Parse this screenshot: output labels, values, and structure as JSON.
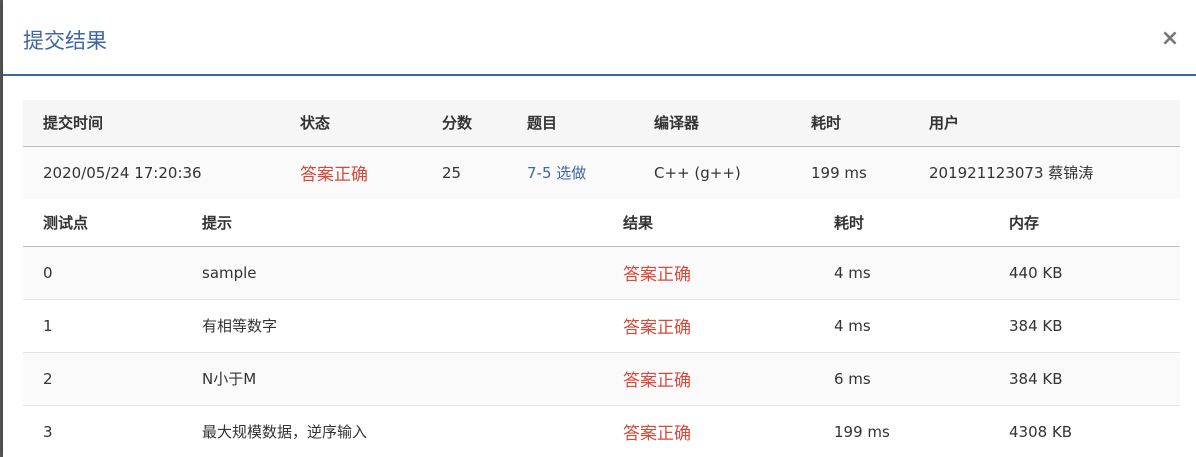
{
  "modal": {
    "title": "提交结果",
    "close_label": "×"
  },
  "summary": {
    "headers": [
      "提交时间",
      "状态",
      "分数",
      "题目",
      "编译器",
      "耗时",
      "用户"
    ],
    "row": {
      "time": "2020/05/24 17:20:36",
      "status": "答案正确",
      "score": "25",
      "problem": "7-5 选做",
      "compiler": "C++ (g++)",
      "elapsed": "199 ms",
      "user": "201921123073 蔡锦涛"
    }
  },
  "tests": {
    "headers": [
      "测试点",
      "提示",
      "结果",
      "耗时",
      "内存"
    ],
    "rows": [
      {
        "id": "0",
        "hint": "sample",
        "result": "答案正确",
        "time": "4 ms",
        "memory": "440 KB"
      },
      {
        "id": "1",
        "hint": "有相等数字",
        "result": "答案正确",
        "time": "4 ms",
        "memory": "384 KB"
      },
      {
        "id": "2",
        "hint": "N小于M",
        "result": "答案正确",
        "time": "6 ms",
        "memory": "384 KB"
      },
      {
        "id": "3",
        "hint": "最大规模数据，逆序输入",
        "result": "答案正确",
        "time": "199 ms",
        "memory": "4308 KB"
      }
    ]
  },
  "colors": {
    "accent": "#3f66a4",
    "success_text": "#d64a3b"
  }
}
